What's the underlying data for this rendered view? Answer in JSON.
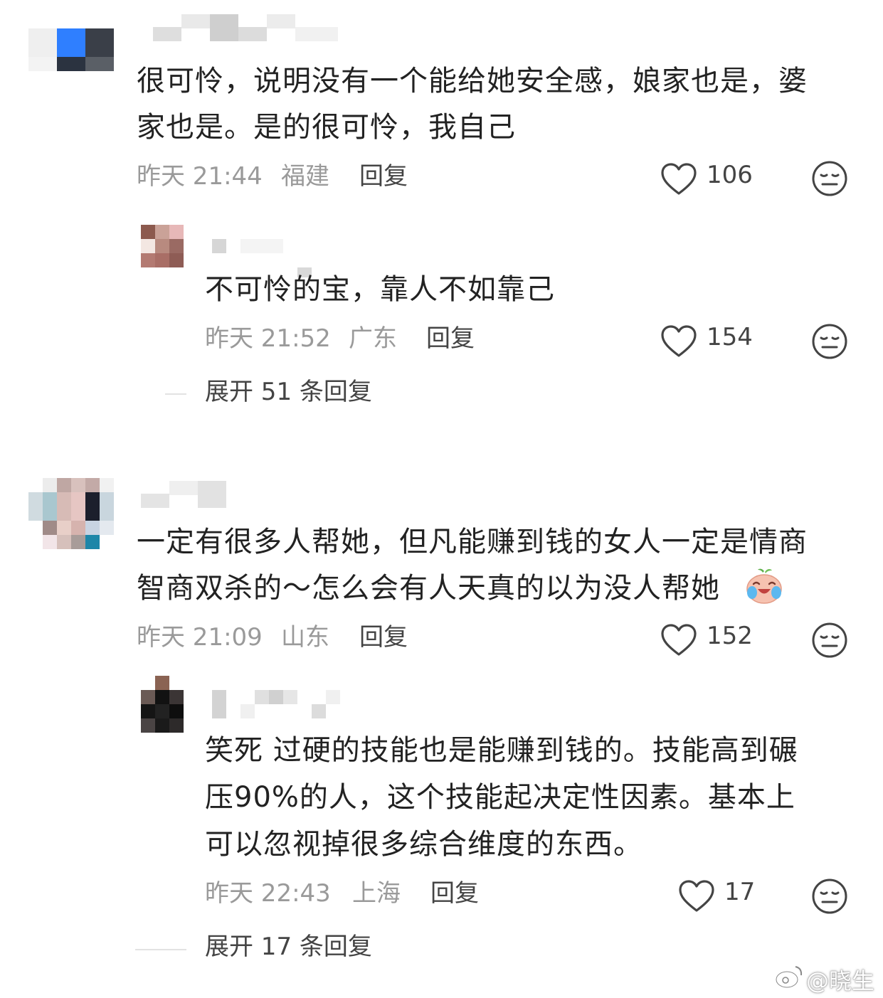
{
  "comments": [
    {
      "text_line1": "很可怜，说明没有一个能给她安全感，娘家也是，婆",
      "text_line2": "家也是。是的很可怜，我自己",
      "time": "昨天 21:44",
      "location": "福建",
      "reply_label": "回复",
      "likes": "106",
      "reply": {
        "text_line1": "不可怜的宝，靠人不如靠己",
        "time": "昨天 21:52",
        "location": "广东",
        "reply_label": "回复",
        "likes": "154"
      },
      "expand_label": "展开 51 条回复"
    },
    {
      "text_line1": "一定有很多人帮她，但凡能赚到钱的女人一定是情商",
      "text_line2": "智商双杀的～怎么会有人天真的以为没人帮她",
      "time": "昨天 21:09",
      "location": "山东",
      "reply_label": "回复",
      "likes": "152",
      "reply": {
        "text_line1": "笑死 过硬的技能也是能赚到钱的。技能高到碾",
        "text_line2": "压90%的人，这个技能起决定性因素。基本上",
        "text_line3": "可以忽视掉很多综合维度的东西。",
        "time": "昨天 22:43",
        "location": "上海",
        "reply_label": "回复",
        "likes": "17"
      },
      "expand_label": "展开 17 条回复"
    }
  ],
  "icons": {
    "like": "heart-outline-icon",
    "dislike": "neutral-face-icon",
    "emoji": "crying-laughing-peach-emoji"
  },
  "watermark": {
    "text": "@晓生"
  },
  "colors": {
    "meta": "#9a9a9a",
    "text": "#222222",
    "divider": "#e2e2e2"
  }
}
